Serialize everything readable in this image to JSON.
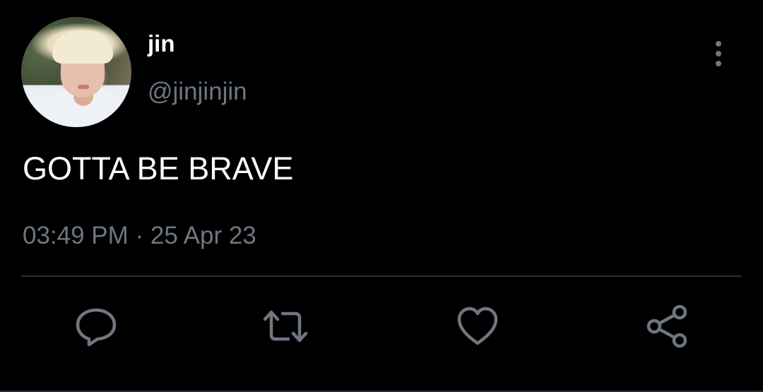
{
  "tweet": {
    "display_name": "jin",
    "username": "@jinjinjin",
    "text": "GOTTA BE BRAVE",
    "timestamp": "03:49 PM · 25 Apr 23"
  },
  "icons": {
    "more": "more-vertical-icon",
    "reply": "reply-icon",
    "retweet": "retweet-icon",
    "like": "heart-icon",
    "share": "share-icon"
  },
  "colors": {
    "background": "#000000",
    "primary_text": "#ffffff",
    "secondary_text": "#6e7681",
    "divider": "#2a2d31"
  }
}
